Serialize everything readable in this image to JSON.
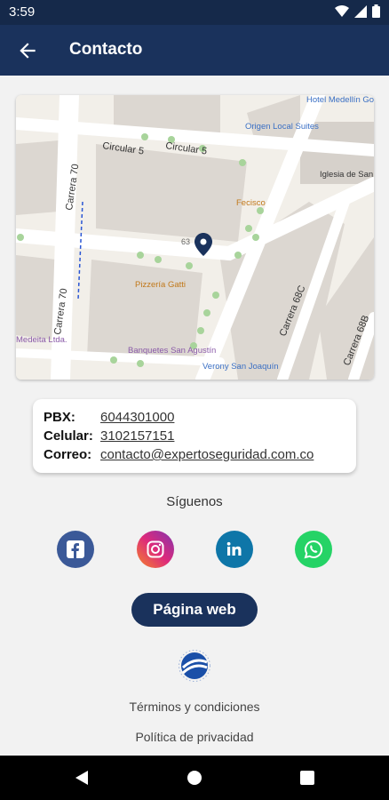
{
  "status_bar": {
    "time": "3:59",
    "icons": [
      "wifi-icon",
      "signal-icon",
      "battery-icon"
    ]
  },
  "app_bar": {
    "title": "Contacto",
    "back_icon": "arrow-left-icon"
  },
  "map": {
    "labels": {
      "circular5_a": "Circular 5",
      "circular5_b": "Circular 5",
      "carrera70_a": "Carrera 70",
      "carrera70_b": "Carrera 70",
      "carrera68c": "Carrera 68C",
      "carrera68b": "Carrera 68B",
      "hotel": "Hotel Medellín Gold HMG",
      "origen": "Origen Local Suites",
      "iglesia": "Iglesia de San Joaquín",
      "fecisco": "Fecisco",
      "pizzeria": "Pizzería Gatti",
      "banquetes": "Banquetes San Agustín",
      "verony": "Verony San Joaquín",
      "medeita": "Medeita Ltda.",
      "number": "63"
    }
  },
  "contact": {
    "pbx_label": "PBX:",
    "pbx_value": "6044301000",
    "cel_label": "Celular:",
    "cel_value": "3102157151",
    "mail_label": "Correo:",
    "mail_value": "contacto@expertoseguridad.com.co"
  },
  "follow_label": "Síguenos",
  "social": [
    {
      "name": "facebook",
      "color": "#3b5998"
    },
    {
      "name": "instagram",
      "color": "#d6249f"
    },
    {
      "name": "linkedin",
      "color": "#0e76a8"
    },
    {
      "name": "whatsapp",
      "color": "#25d366"
    }
  ],
  "web_button": "Página web",
  "links": {
    "terms": "Términos y condiciones",
    "privacy": "Política de privacidad"
  }
}
